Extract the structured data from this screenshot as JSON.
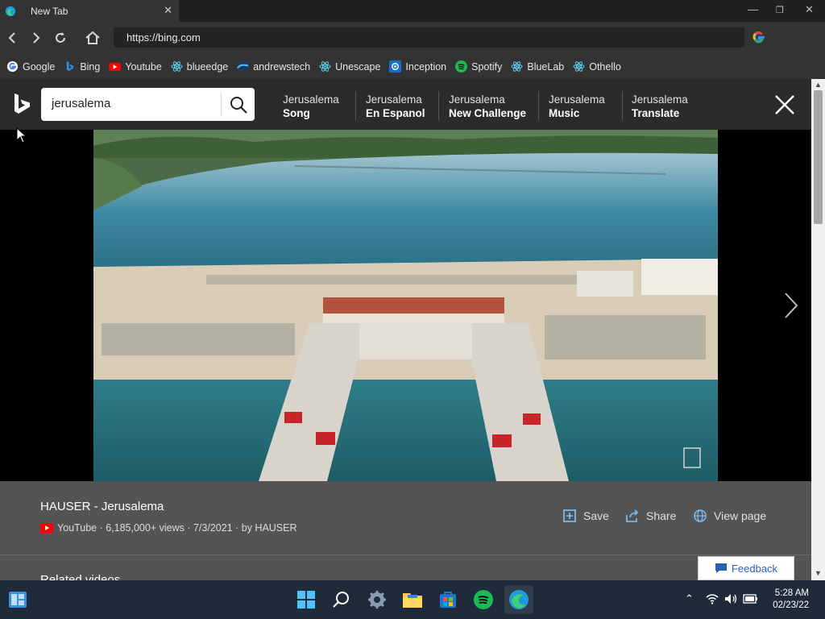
{
  "browser": {
    "tab_title": "New Tab",
    "url": "https://bing.com",
    "bookmarks": [
      {
        "label": "Google",
        "icon": "google-icon"
      },
      {
        "label": "Bing",
        "icon": "bing-icon"
      },
      {
        "label": "Youtube",
        "icon": "youtube-icon"
      },
      {
        "label": "blueedge",
        "icon": "react-icon"
      },
      {
        "label": "andrewstech",
        "icon": "wave-icon"
      },
      {
        "label": "Unescape",
        "icon": "react-icon"
      },
      {
        "label": "Inception",
        "icon": "inception-icon"
      },
      {
        "label": "Spotify",
        "icon": "spotify-icon"
      },
      {
        "label": "BlueLab",
        "icon": "react-icon"
      },
      {
        "label": "Othello",
        "icon": "react-icon"
      }
    ]
  },
  "bing": {
    "query": "jerusalema",
    "related": [
      {
        "line1": "Jerusalema",
        "line2": "Song"
      },
      {
        "line1": "Jerusalema",
        "line2": "En Espanol"
      },
      {
        "line1": "Jerusalema",
        "line2": "New Challenge"
      },
      {
        "line1": "Jerusalema",
        "line2": "Music"
      },
      {
        "line1": "Jerusalema",
        "line2": "Translate"
      }
    ],
    "video": {
      "title": "HAUSER - Jerusalema",
      "meta": "YouTube · 6,185,000+ views · 7/3/2021 · by HAUSER",
      "actions": {
        "save": "Save",
        "share": "Share",
        "view_page": "View page"
      }
    },
    "related_videos_label": "Related videos",
    "feedback_label": "Feedback"
  },
  "taskbar": {
    "time": "5:28 AM",
    "date": "02/23/22"
  },
  "colors": {
    "accent": "#0078d4",
    "youtube_red": "#ff0000",
    "spotify_green": "#1db954"
  }
}
